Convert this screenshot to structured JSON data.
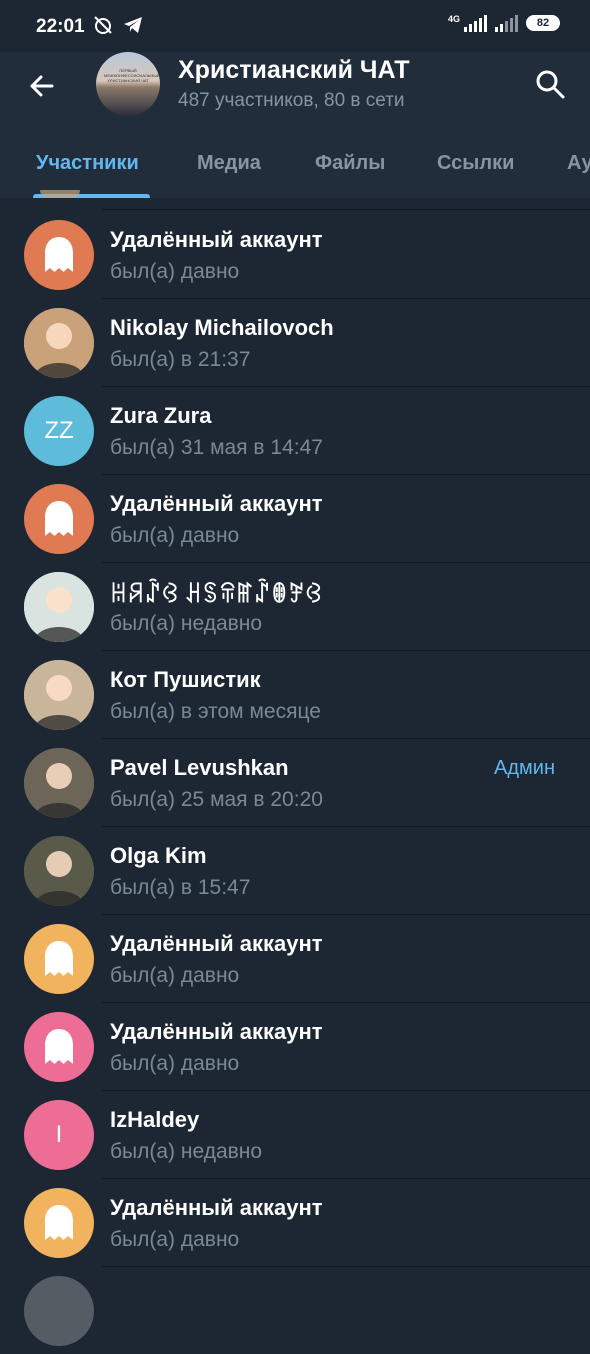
{
  "statusbar": {
    "time": "22:01",
    "network": "4G",
    "battery": "82"
  },
  "header": {
    "title": "Христианский ЧАТ",
    "subtitle": "487 участников, 80 в сети",
    "avatar_text": "ПЕРВЫЙ МЕЖКОНФЕССИОНАЛЬНЫЙ ХРИСТИАНСКИЙ ЧАТ"
  },
  "tabs": [
    "Участники",
    "Медиа",
    "Файлы",
    "Ссылки",
    "Ау"
  ],
  "members": [
    {
      "name": "Удалённый аккаунт",
      "status": "был(а) давно",
      "avatar": "ghost",
      "color": "#e07a53",
      "initials": "",
      "badge": ""
    },
    {
      "name": "Nikolay Michailovoch",
      "status": "был(а) в 21:37",
      "avatar": "photo",
      "color": "#c9a27a",
      "initials": "",
      "badge": ""
    },
    {
      "name": "Zura Zura",
      "status": "был(а) 31 мая в 14:47",
      "avatar": "initials",
      "color": "#5cbcd9",
      "initials": "ZZ",
      "badge": ""
    },
    {
      "name": "Удалённый аккаунт",
      "status": "был(а) давно",
      "avatar": "ghost",
      "color": "#e07a53",
      "initials": "",
      "badge": ""
    },
    {
      "name": "ꀍꋪꁳꃳ ꃅꌗꋖꂵꁳꂦꎇꃳ",
      "status": "был(а) недавно",
      "avatar": "photo",
      "color": "#d9e4e0",
      "initials": "",
      "badge": ""
    },
    {
      "name": "Кот Пушистик",
      "status": "был(а) в этом месяце",
      "avatar": "photo",
      "color": "#c9b59a",
      "initials": "",
      "badge": ""
    },
    {
      "name": "Pavel Levushkan",
      "status": "был(а) 25 мая в 20:20",
      "avatar": "photo",
      "color": "#6d6658",
      "initials": "",
      "badge": "Админ"
    },
    {
      "name": "Olga Kim",
      "status": "был(а) в 15:47",
      "avatar": "photo",
      "color": "#5a5a4a",
      "initials": "",
      "badge": ""
    },
    {
      "name": "Удалённый аккаунт",
      "status": "был(а) давно",
      "avatar": "ghost",
      "color": "#f2b35e",
      "initials": "",
      "badge": ""
    },
    {
      "name": "Удалённый аккаунт",
      "status": "был(а) давно",
      "avatar": "ghost",
      "color": "#ee6d95",
      "initials": "",
      "badge": ""
    },
    {
      "name": "IzHaldey",
      "status": "был(а) недавно",
      "avatar": "initials",
      "color": "#ee6d95",
      "initials": "I",
      "badge": ""
    },
    {
      "name": "Удалённый аккаунт",
      "status": "был(а) давно",
      "avatar": "ghost",
      "color": "#f2b35e",
      "initials": "",
      "badge": ""
    }
  ]
}
